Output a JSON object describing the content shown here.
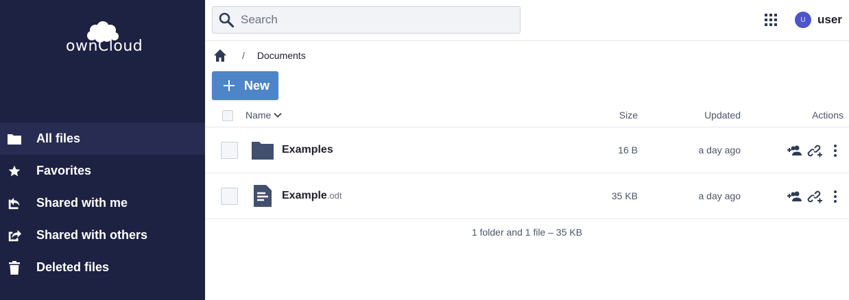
{
  "brand": {
    "logo_text": "ownCloud"
  },
  "sidebar": {
    "items": [
      {
        "label": "All files",
        "icon": "folder-icon",
        "active": true
      },
      {
        "label": "Favorites",
        "icon": "star-icon",
        "active": false
      },
      {
        "label": "Shared with me",
        "icon": "shared-with-me-icon",
        "active": false
      },
      {
        "label": "Shared with others",
        "icon": "shared-with-others-icon",
        "active": false
      },
      {
        "label": "Deleted files",
        "icon": "trash-icon",
        "active": false
      }
    ]
  },
  "header": {
    "search": {
      "placeholder": "Search",
      "value": ""
    },
    "apps_icon": "grid-icon",
    "avatar_initial": "U",
    "username": "user"
  },
  "breadcrumb": {
    "separator": "/",
    "current": "Documents"
  },
  "new_button": {
    "label": "New"
  },
  "table": {
    "columns": {
      "name": "Name",
      "size": "Size",
      "updated": "Updated",
      "actions": "Actions"
    },
    "rows": [
      {
        "name": "Examples",
        "ext": "",
        "type": "folder",
        "size": "16 B",
        "updated": "a day ago"
      },
      {
        "name": "Example",
        "ext": ".odt",
        "type": "document",
        "size": "35 KB",
        "updated": "a day ago"
      }
    ]
  },
  "summary": "1 folder and 1 file – 35 KB",
  "colors": {
    "sidebar_bg": "#1d2142",
    "sidebar_active": "#282c52",
    "primary_button": "#4e85c8",
    "icon_dark": "#424f6e",
    "avatar": "#4c54c8"
  }
}
